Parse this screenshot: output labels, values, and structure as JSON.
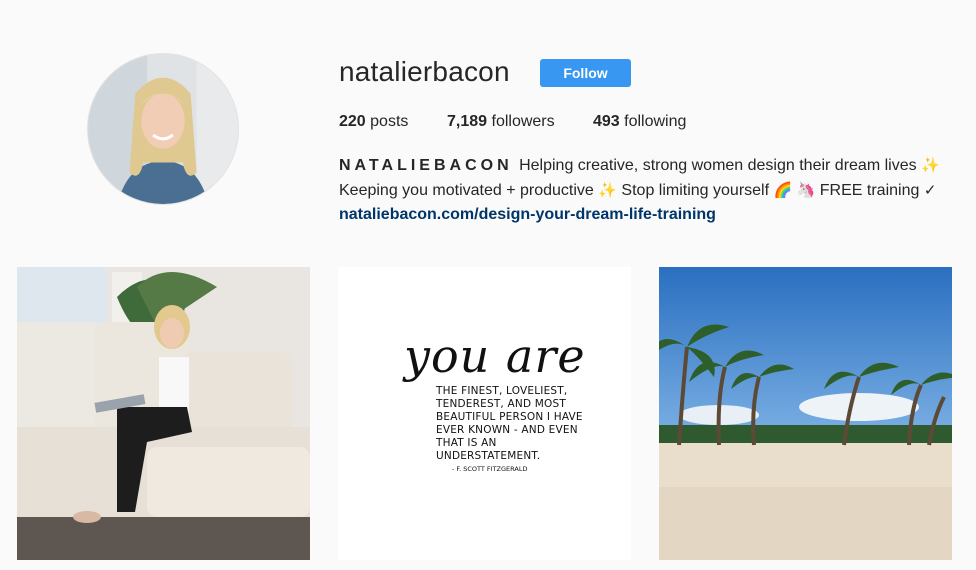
{
  "profile": {
    "username": "natalierbacon",
    "follow_label": "Follow",
    "stats": {
      "posts_count": "220",
      "posts_label": " posts",
      "followers_count": "7,189",
      "followers_label": " followers",
      "following_count": "493",
      "following_label": " following"
    },
    "bio": {
      "name": "NATALIEBACON",
      "line1": "Helping creative, strong women design their dream lives",
      "line1_emoji": "✨",
      "line2": "Keeping you motivated + productive",
      "line2_emoji": "✨",
      "line2b": "Stop limiting yourself",
      "line2b_emoji1": "🌈",
      "line2b_emoji2": "🦄",
      "line2c": "FREE training",
      "line2c_emoji": "✓",
      "link": "nataliebacon.com/design-your-dream-life-training"
    }
  },
  "posts": {
    "quote": {
      "script": "you are",
      "body": "THE FINEST, LOVELIEST, TENDEREST, AND MOST BEAUTIFUL PERSON I HAVE EVER KNOWN - AND EVEN THAT IS AN UNDERSTATEMENT.",
      "attribution": "- F. SCOTT FITZGERALD"
    }
  },
  "colors": {
    "accent": "#3897f0",
    "link": "#003569",
    "background": "#fafafa"
  }
}
